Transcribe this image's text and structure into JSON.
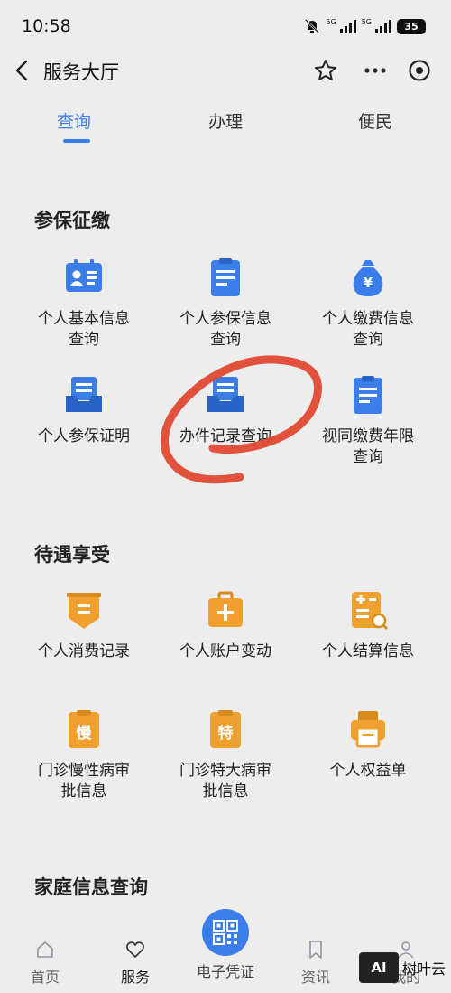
{
  "status_bar": {
    "time": "10:58",
    "sim1_label": "5G",
    "sim2_label": "5G",
    "battery": "35"
  },
  "nav": {
    "title": "服务大厅"
  },
  "tabs": [
    {
      "label": "查询",
      "active": true
    },
    {
      "label": "办理",
      "active": false
    },
    {
      "label": "便民",
      "active": false
    }
  ],
  "sections": {
    "enrollment": {
      "title": "参保征缴",
      "items": [
        {
          "label": "个人基本信息查询",
          "icon": "id-card-icon"
        },
        {
          "label": "个人参保信息查询",
          "icon": "document-icon"
        },
        {
          "label": "个人缴费信息查询",
          "icon": "money-bag-icon"
        },
        {
          "label": "个人参保证明",
          "icon": "inbox-tray-icon"
        },
        {
          "label": "办件记录查询",
          "icon": "inbox-tray-icon"
        },
        {
          "label": "视同缴费年限查询",
          "icon": "document-icon"
        }
      ]
    },
    "benefits": {
      "title": "待遇享受",
      "items": [
        {
          "label": "个人消费记录",
          "icon": "receipt-icon"
        },
        {
          "label": "个人账户变动",
          "icon": "medical-kit-icon"
        },
        {
          "label": "个人结算信息",
          "icon": "calculator-icon"
        },
        {
          "label": "门诊慢性病审批信息",
          "icon": "chronic-card-icon"
        },
        {
          "label": "门诊特大病审批信息",
          "icon": "special-card-icon"
        },
        {
          "label": "个人权益单",
          "icon": "printer-icon"
        }
      ]
    },
    "family": {
      "title": "家庭信息查询"
    }
  },
  "bottom_nav": {
    "items": [
      {
        "label": "首页",
        "icon": "home-icon"
      },
      {
        "label": "服务",
        "icon": "heart-icon"
      },
      {
        "label": "电子凭证",
        "icon": "qr-code-icon"
      },
      {
        "label": "资讯",
        "icon": "bookmark-icon"
      },
      {
        "label": "我的",
        "icon": "user-icon"
      }
    ]
  },
  "watermark": {
    "logo": "AI",
    "text": "树叶云"
  },
  "colors": {
    "accent_blue": "#3b7de9",
    "accent_orange": "#f0a030",
    "annotation_red": "#e0432c",
    "background": "#ededed"
  }
}
